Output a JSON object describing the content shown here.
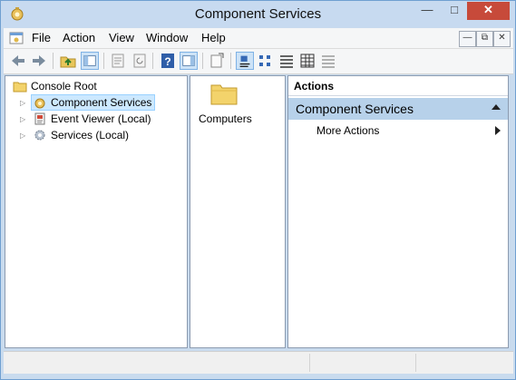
{
  "window": {
    "title": "Component Services"
  },
  "menubar": {
    "items": [
      "File",
      "Action",
      "View",
      "Window",
      "Help"
    ]
  },
  "tree": {
    "root_label": "Console Root",
    "items": [
      {
        "label": "Component Services",
        "selected": true
      },
      {
        "label": "Event Viewer (Local)",
        "selected": false
      },
      {
        "label": "Services (Local)",
        "selected": false
      }
    ]
  },
  "results": {
    "items": [
      {
        "label": "Computers"
      }
    ]
  },
  "actions": {
    "header": "Actions",
    "section_title": "Component Services",
    "items": [
      {
        "label": "More Actions"
      }
    ]
  },
  "colors": {
    "title_bar": "#c7daf0",
    "close_button": "#c74a3a",
    "selection": "#cce8ff",
    "actions_section": "#b7d1ea"
  }
}
